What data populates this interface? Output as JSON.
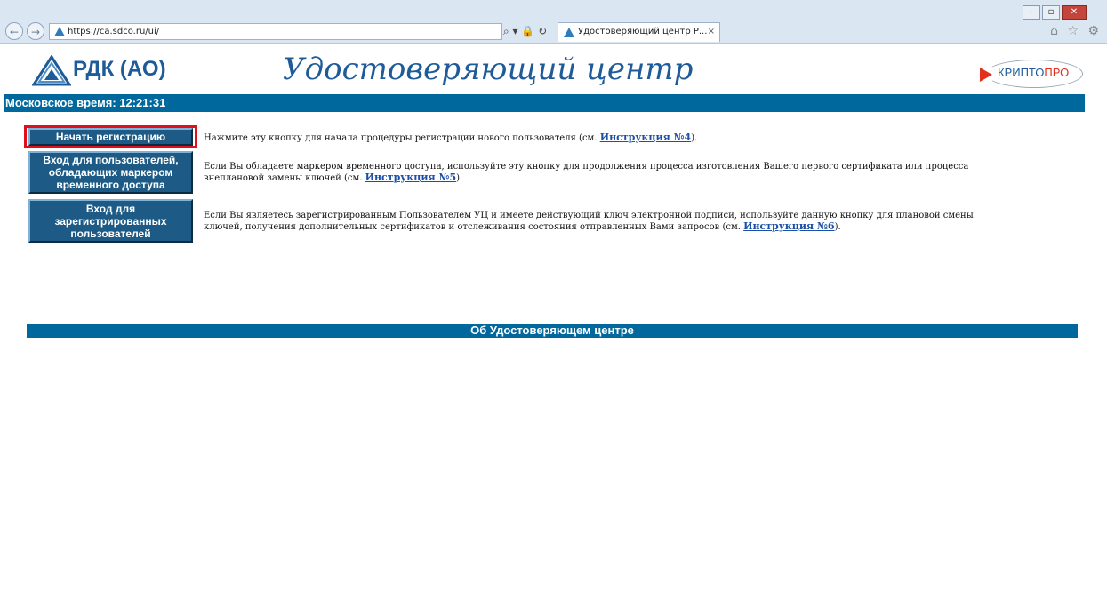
{
  "browser": {
    "back_icon": "back-arrow-icon",
    "forward_icon": "forward-arrow-icon",
    "url": "https://ca.sdco.ru/ui/",
    "address_tools": "⌕ ▾ 🔒 ↻",
    "tab_title": "Удостоверяющий центр Р...",
    "tab_close": "×",
    "window_controls": [
      "–",
      "▫",
      "✕"
    ],
    "right_icons": "⌂ ☆ ⚙"
  },
  "header": {
    "brand": "РДК (АО)",
    "title": "Удостоверяющий центр",
    "partner_logo_left": "КРИПТО",
    "partner_logo_right": "ПРО"
  },
  "time_bar": {
    "text": "Московское время: 12:21:31"
  },
  "actions": [
    {
      "button": "Начать регистрацию",
      "desc_before": "Нажмите эту кнопку для начала процедуры регистрации нового пользователя (см. ",
      "link": "Инструкция №4",
      "desc_after": ")."
    },
    {
      "button": "Вход для пользователей, обладающих маркером временного доступа",
      "desc_before": "Если Вы обладаете маркером временного доступа, используйте эту кнопку для продолжения процесса изготовления Вашего первого сертификата или процесса внеплановой замены ключей (см. ",
      "link": "Инструкция №5",
      "desc_after": ")."
    },
    {
      "button": "Вход для зарегистрированных пользователей",
      "desc_before": "Если Вы являетесь зарегистрированным Пользователем УЦ и имеете действующий ключ электронной подписи, используйте данную кнопку для плановой смены ключей, получения дополнительных сертификатов и отслеживания состояния отправленных Вами запросов (см. ",
      "link": "Инструкция №6",
      "desc_after": ")."
    }
  ],
  "about": {
    "label": "Об Удостоверяющем центре"
  },
  "colors": {
    "brand_blue": "#1f5b99",
    "bar_blue": "#00689d",
    "button_blue": "#1d5b86",
    "highlight_red": "#e0101a"
  }
}
